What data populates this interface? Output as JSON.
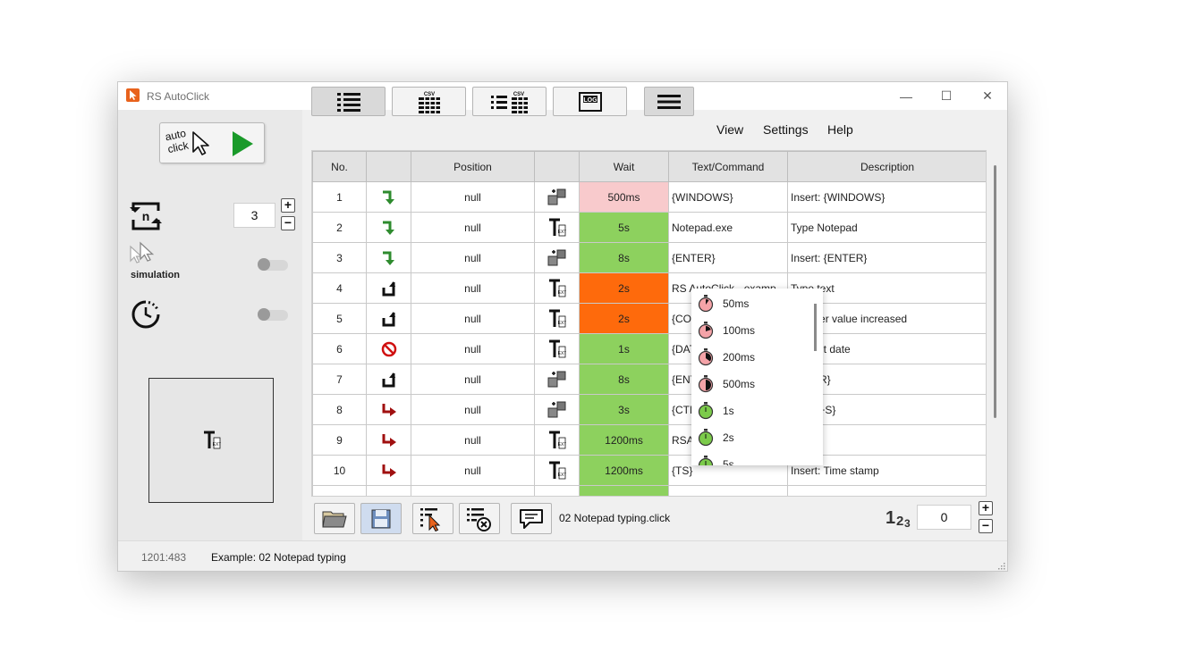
{
  "window": {
    "title": "RS AutoClick",
    "minimize": "—",
    "maximize": "☐",
    "close": "✕"
  },
  "left_panel": {
    "autoclick_line1": "auto",
    "autoclick_line2": "click",
    "repeat_count": "3",
    "plus": "+",
    "minus": "−",
    "simulation_label": "simulation",
    "simulation_enabled": false,
    "timer_enabled": false
  },
  "menu": {
    "view": "View",
    "settings": "Settings",
    "help": "Help"
  },
  "table": {
    "headers": [
      "No.",
      "",
      "Position",
      "",
      "Wait",
      "Text/Command",
      "Description"
    ],
    "rows": [
      {
        "no": "1",
        "action": "arrow-down-green",
        "position": "null",
        "type": "key",
        "wait": "500ms",
        "wait_color": "pink",
        "text": "{WINDOWS}",
        "desc": "Insert: {WINDOWS}"
      },
      {
        "no": "2",
        "action": "arrow-down-green",
        "position": "null",
        "type": "text",
        "wait": "5s",
        "wait_color": "green",
        "text": "Notepad.exe",
        "desc": "Type Notepad"
      },
      {
        "no": "3",
        "action": "arrow-down-green",
        "position": "null",
        "type": "key",
        "wait": "8s",
        "wait_color": "green",
        "text": "{ENTER}",
        "desc": "Insert: {ENTER}"
      },
      {
        "no": "4",
        "action": "arrow-up-black",
        "position": "null",
        "type": "text",
        "wait": "2s",
        "wait_color": "orange",
        "text": "RS AutoClick - examp",
        "desc": "Type text"
      },
      {
        "no": "5",
        "action": "arrow-up-black",
        "position": "null",
        "type": "text",
        "wait": "2s",
        "wait_color": "orange",
        "text": "{CO",
        "desc": "Counter value increased"
      },
      {
        "no": "6",
        "action": "no-red",
        "position": "null",
        "type": "text",
        "wait": "1s",
        "wait_color": "green",
        "text": "{DAT",
        "desc": "Current date"
      },
      {
        "no": "7",
        "action": "arrow-up-black",
        "position": "null",
        "type": "key",
        "wait": "8s",
        "wait_color": "green",
        "text": "{ENT",
        "desc": "ENTER}"
      },
      {
        "no": "8",
        "action": "arrow-right-red",
        "position": "null",
        "type": "key",
        "wait": "3s",
        "wait_color": "green",
        "text": "{CTR",
        "desc": "CTRL+S}"
      },
      {
        "no": "9",
        "action": "arrow-right-red",
        "position": "null",
        "type": "text",
        "wait": "1200ms",
        "wait_color": "green",
        "text": "RSA",
        "desc": "xt"
      },
      {
        "no": "10",
        "action": "arrow-right-red",
        "position": "null",
        "type": "text",
        "wait": "1200ms",
        "wait_color": "green",
        "text": "{TS}",
        "desc": "Insert: Time stamp"
      }
    ]
  },
  "wait_popup": {
    "items": [
      {
        "label": "50ms",
        "icon": "stopwatch-50ms-icon",
        "color": "#f4a3a8"
      },
      {
        "label": "100ms",
        "icon": "stopwatch-100ms-icon",
        "color": "#f4a3a8"
      },
      {
        "label": "200ms",
        "icon": "stopwatch-200ms-icon",
        "color": "#f4a3a8"
      },
      {
        "label": "500ms",
        "icon": "stopwatch-500ms-icon",
        "color": "#f4a3a8"
      },
      {
        "label": "1s",
        "icon": "stopwatch-1s-icon",
        "color": "#7ccb4b"
      },
      {
        "label": "2s",
        "icon": "stopwatch-2s-icon",
        "color": "#7ccb4b"
      },
      {
        "label": "5s",
        "icon": "stopwatch-5s-icon",
        "color": "#7ccb4b"
      }
    ]
  },
  "bottom": {
    "filename": "02 Notepad typing.click",
    "number_value": "0",
    "number_icon_text": "123"
  },
  "status": {
    "coords": "1201:483",
    "text": "Example: 02 Notepad typing"
  },
  "colors": {
    "wait_green": "#8dd15e",
    "wait_orange": "#fe6a0c",
    "wait_pink": "#f8cacc",
    "arrow_green": "#2e8b2e",
    "arrow_red": "#a01010",
    "no_red": "#d01010",
    "app_icon": "#e8621c"
  }
}
